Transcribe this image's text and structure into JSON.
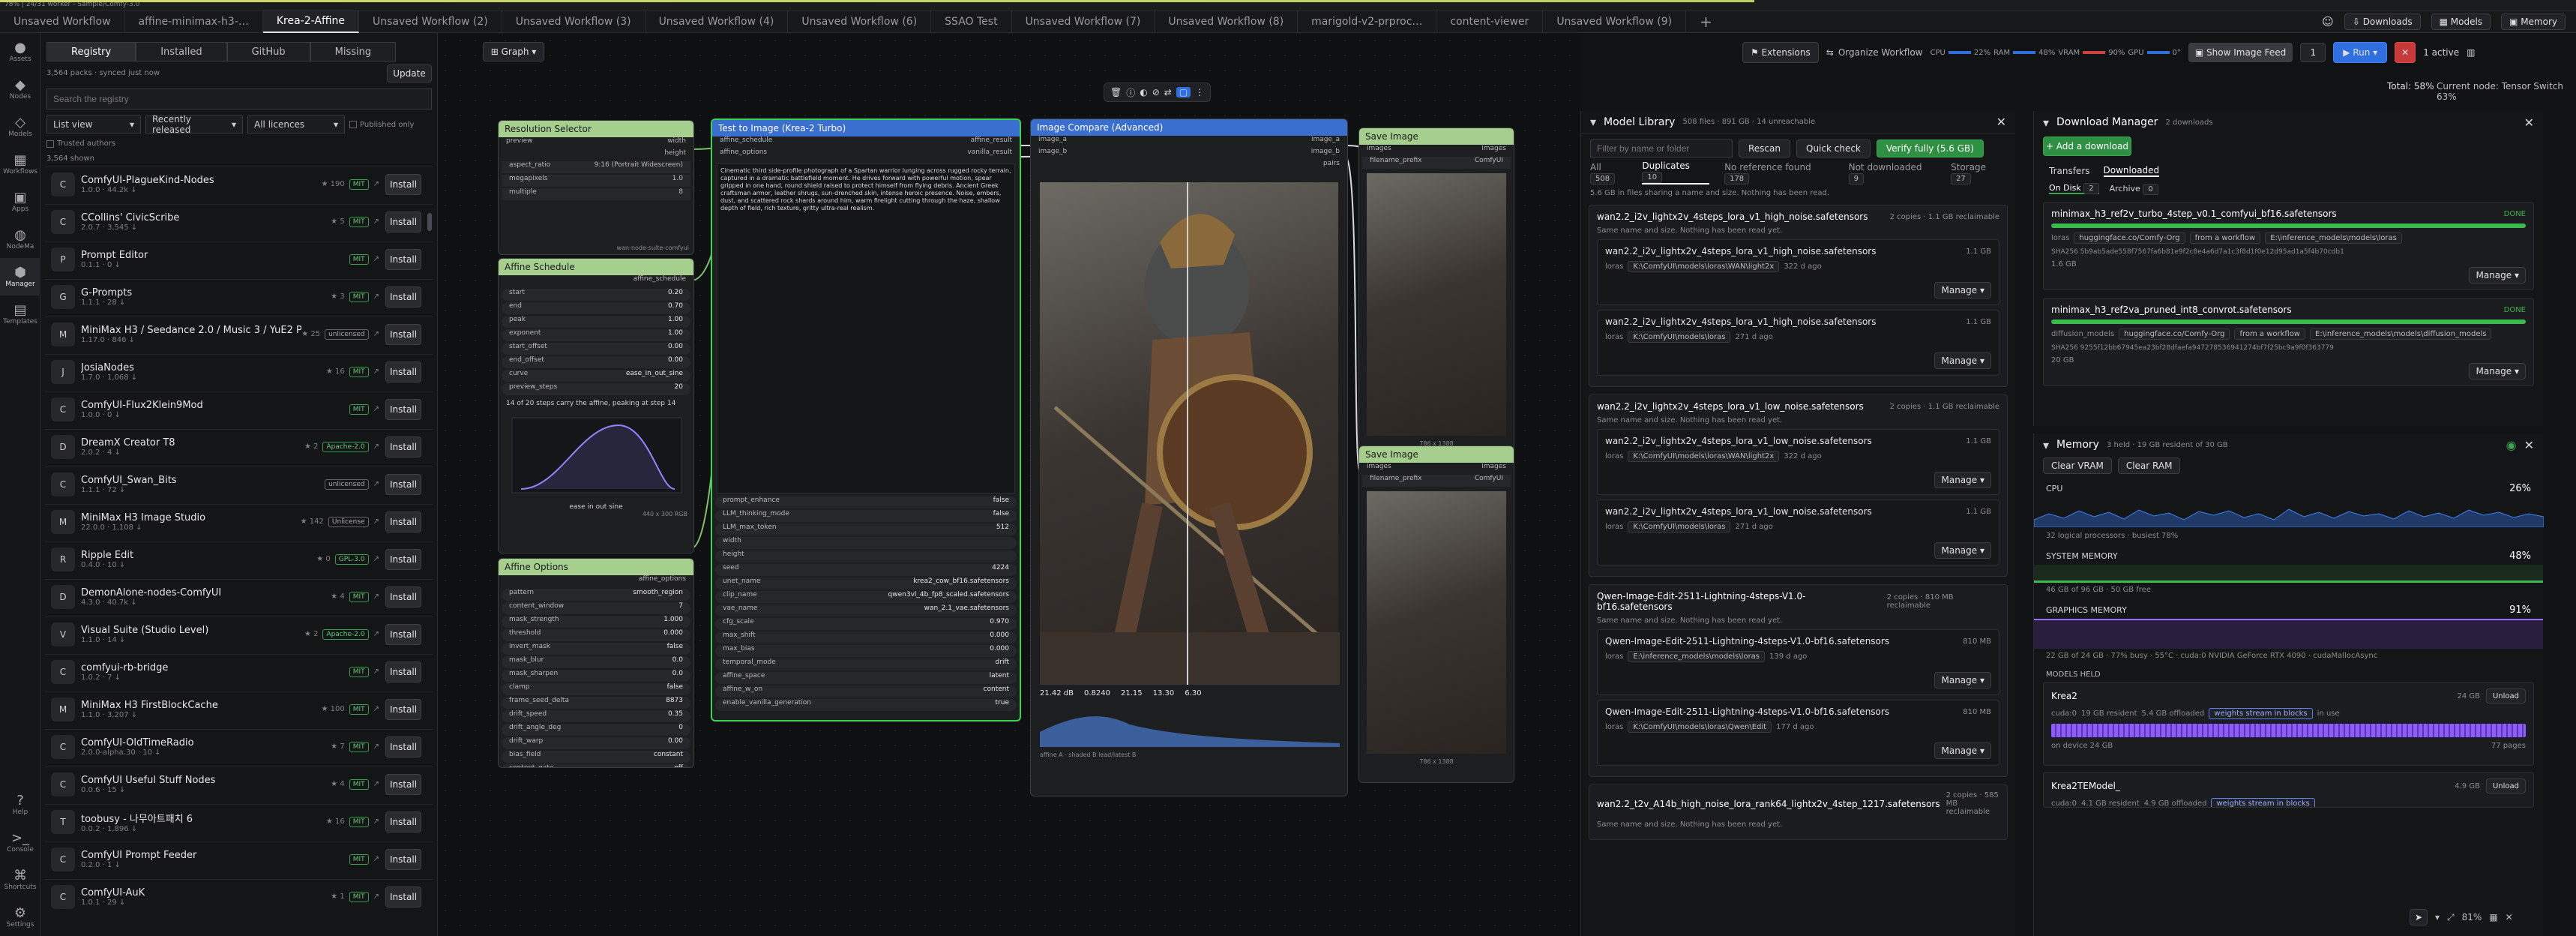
{
  "status_line": "78% | 24/31 worker - Sample/Comfy-3.0",
  "tabs": [
    "Unsaved Workflow",
    "affine-minimax-h3-…",
    "Krea-2-Affine",
    "Unsaved Workflow (2)",
    "Unsaved Workflow (3)",
    "Unsaved Workflow (4)",
    "Unsaved Workflow (6)",
    "SSAO Test",
    "Unsaved Workflow (7)",
    "Unsaved Workflow (8)",
    "marigold-v2-prproc…",
    "content-viewer",
    "Unsaved Workflow (9)"
  ],
  "topbar": {
    "downloads": "Downloads",
    "models": "Models",
    "memory": "Memory",
    "total": "Total: 58%",
    "current_node": "Current node: Tensor Switch 63%"
  },
  "rail": [
    {
      "icon": "●",
      "label": "Assets"
    },
    {
      "icon": "◆",
      "label": "Nodes"
    },
    {
      "icon": "◇",
      "label": "Models"
    },
    {
      "icon": "▦",
      "label": "Workflows"
    },
    {
      "icon": "▣",
      "label": "Apps"
    },
    {
      "icon": "◍",
      "label": "NodeMa"
    },
    {
      "icon": "⬢",
      "label": "Manager"
    },
    {
      "icon": "▤",
      "label": "Templates"
    },
    {
      "icon": "?",
      "label": "Help"
    },
    {
      "icon": ">_",
      "label": "Console"
    },
    {
      "icon": "⌘",
      "label": "Shortcuts"
    },
    {
      "icon": "⚙",
      "label": "Settings"
    }
  ],
  "manager": {
    "tabs": [
      "Registry",
      "Installed",
      "GitHub",
      "Missing"
    ],
    "count_line": "3,564 packs · synced just now",
    "update": "Update",
    "search_placeholder": "Search the registry",
    "view": "List view",
    "sort": "Recently released",
    "licences": "All licences",
    "published_only": "Published only",
    "trusted": "Trusted authors",
    "shown": "3,564 shown",
    "install": "Install",
    "packs": [
      {
        "icon": "C",
        "name": "ComfyUI-PlagueKind-Nodes",
        "meta": "1.0.0 · 44.2k ↓",
        "badge": "MIT",
        "stars": "★ 190"
      },
      {
        "icon": "C",
        "name": "CCollins' CivicScribe",
        "meta": "2.0.7 · 3,545 ↓",
        "badge": "MIT",
        "stars": "★ 5"
      },
      {
        "icon": "P",
        "name": "Prompt Editor",
        "meta": "0.1.1 · 0 ↓",
        "badge": "MIT",
        "stars": ""
      },
      {
        "icon": "G",
        "name": "G-Prompts",
        "meta": "1.1.1 · 28 ↓",
        "badge": "MIT",
        "stars": "★ 3"
      },
      {
        "icon": "M",
        "name": "MiniMax H3 / Seedance 2.0 / Music 3 / YuE2 Prompt Enhancer (TB)",
        "meta": "1.17.0 · 846 ↓",
        "badge": "unlicensed",
        "stars": "★ 25"
      },
      {
        "icon": "J",
        "name": "JosiaNodes",
        "meta": "1.7.0 · 1,068 ↓",
        "badge": "MIT",
        "stars": "★ 16"
      },
      {
        "icon": "C",
        "name": "ComfyUI-Flux2Klein9Mod",
        "meta": "1.0.0 · 0 ↓",
        "badge": "MIT",
        "stars": ""
      },
      {
        "icon": "D",
        "name": "DreamX Creator T8",
        "meta": "2.0.2 · 4 ↓",
        "badge": "Apache-2.0",
        "stars": "★ 2"
      },
      {
        "icon": "C",
        "name": "ComfyUI_Swan_Bits",
        "meta": "1.1.1 · 72 ↓",
        "badge": "unlicensed",
        "stars": ""
      },
      {
        "icon": "M",
        "name": "MiniMax H3 Image Studio",
        "meta": "22.0.0 · 1,108 ↓",
        "badge": "Unlicense",
        "stars": "★ 142"
      },
      {
        "icon": "R",
        "name": "Ripple Edit",
        "meta": "0.4.0 · 10 ↓",
        "badge": "GPL-3.0",
        "stars": "★ 0"
      },
      {
        "icon": "D",
        "name": "DemonAlone-nodes-ComfyUI",
        "meta": "4.3.0 · 40.7k ↓",
        "badge": "MIT",
        "stars": "★ 4"
      },
      {
        "icon": "V",
        "name": "Visual Suite (Studio Level)",
        "meta": "1.1.0 · 14 ↓",
        "badge": "Apache-2.0",
        "stars": "★ 2"
      },
      {
        "icon": "C",
        "name": "comfyui-rb-bridge",
        "meta": "1.0.2 · 7 ↓",
        "badge": "MIT",
        "stars": ""
      },
      {
        "icon": "M",
        "name": "MiniMax H3 FirstBlockCache",
        "meta": "1.1.0 · 3,207 ↓",
        "badge": "MIT",
        "stars": "★ 100"
      },
      {
        "icon": "C",
        "name": "ComfyUI-OldTimeRadio",
        "meta": "2.0.0-alpha.30 · 10 ↓",
        "badge": "MIT",
        "stars": "★ 7"
      },
      {
        "icon": "C",
        "name": "ComfyUI Useful Stuff Nodes",
        "meta": "0.0.6 · 15 ↓",
        "badge": "MIT",
        "stars": "★ 4"
      },
      {
        "icon": "T",
        "name": "toobusy - 나무아트패치 6",
        "meta": "0.0.2 · 1,896 ↓",
        "badge": "MIT",
        "stars": "★ 16"
      },
      {
        "icon": "C",
        "name": "ComfyUI Prompt Feeder",
        "meta": "0.2.0 · 1 ↓",
        "badge": "MIT",
        "stars": ""
      },
      {
        "icon": "C",
        "name": "ComfyUI-AuK",
        "meta": "1.0.1 · 29 ↓",
        "badge": "MIT",
        "stars": "★ 1"
      }
    ]
  },
  "graph": {
    "label": "Graph",
    "res_node": {
      "title": "Resolution Selector",
      "rows": [
        [
          "preview",
          "width"
        ],
        [
          "",
          "height"
        ],
        [
          "aspect_ratio",
          "9:16 (Portrait Widescreen)"
        ],
        [
          "megapixels",
          "1.0"
        ],
        [
          "multiple",
          "8"
        ]
      ],
      "tag": "wan-node-suite-comfyui"
    },
    "sched_node": {
      "title": "Affine Schedule",
      "out": "affine_schedule",
      "rows": [
        [
          "start",
          "0.20"
        ],
        [
          "end",
          "0.70"
        ],
        [
          "peak",
          "1.00"
        ],
        [
          "exponent",
          "1.00"
        ],
        [
          "start_offset",
          "0.00"
        ],
        [
          "end_offset",
          "0.00"
        ],
        [
          "curve",
          "ease_in_out_sine"
        ],
        [
          "preview_steps",
          "20"
        ]
      ],
      "note": "14 of 20 steps carry the affine, peaking at step 14",
      "foot": "440 x 300 RGB",
      "caption": "ease in out sine"
    },
    "opts_node": {
      "title": "Affine Options",
      "out": "affine_options",
      "rows": [
        [
          "pattern",
          "smooth_region"
        ],
        [
          "content_window",
          "7"
        ],
        [
          "mask_strength",
          "1.000"
        ],
        [
          "threshold",
          "0.000"
        ],
        [
          "invert_mask",
          "false"
        ],
        [
          "mask_blur",
          "0.0"
        ],
        [
          "mask_sharpen",
          "0.0"
        ],
        [
          "clamp",
          "false"
        ],
        [
          "frame_seed_delta",
          "8873"
        ],
        [
          "drift_speed",
          "0.35"
        ],
        [
          "drift_angle_deg",
          "0"
        ],
        [
          "drift_warp",
          "0.00"
        ],
        [
          "bias_field",
          "constant"
        ],
        [
          "content_gate",
          "off"
        ]
      ]
    },
    "t2i_node": {
      "title": "Test to Image (Krea-2 Turbo)",
      "ins": [
        "affine_schedule",
        "affine_options"
      ],
      "outs": [
        "affine_result",
        "vanilla_result"
      ],
      "prompt": "Cinematic third side-profile photograph of a Spartan warrior lunging across rugged rocky terrain, captured in a dramatic battlefield moment. He drives forward with powerful motion, spear gripped in one hand, round shield raised to protect himself from flying debris. Ancient Greek craftsman armor, leather shrugs, sun-drenched skin, intense heroic presence. Noise, embers, dust, and scattered rock shards around him, warm firelight cutting through the haze, shallow depth of field, rich texture, gritty ultra-real realism.",
      "rows": [
        [
          "prompt_enhance",
          "false"
        ],
        [
          "LLM_thinking_mode",
          "false"
        ],
        [
          "LLM_max_token",
          "512"
        ],
        [
          "width",
          ""
        ],
        [
          "height",
          ""
        ],
        [
          "seed",
          "4224"
        ],
        [
          "unet_name",
          "krea2_cow_bf16.safetensors"
        ],
        [
          "clip_name",
          "qwen3vl_4b_fp8_scaled.safetensors"
        ],
        [
          "vae_name",
          "wan_2.1_vae.safetensors"
        ],
        [
          "cfg_scale",
          "0.970"
        ],
        [
          "max_shift",
          "0.000"
        ],
        [
          "max_bias",
          "0.000"
        ],
        [
          "temporal_mode",
          "drift"
        ],
        [
          "affine_space",
          "latent"
        ],
        [
          "affine_w_on",
          "content"
        ],
        [
          "enable_vanilla_generation",
          "true"
        ]
      ]
    },
    "cmp_node": {
      "title": "Image Compare (Advanced)",
      "ins": [
        "image_a",
        "image_b"
      ],
      "outs": [
        "image_a",
        "image_b",
        "pairs"
      ],
      "stats": [
        "21.42 dB",
        "0.8240",
        "21.15",
        "13.30",
        "6.30"
      ],
      "foot": "affine A · shaded B lead/latest B"
    },
    "save1": {
      "title": "Save Image",
      "in": "images",
      "sub": "filename_prefix",
      "val": "ComfyUI",
      "foot": "786 x 1388"
    },
    "save2": {
      "title": "Save Image",
      "in": "images",
      "sub": "filename_prefix",
      "val": "ComfyUI",
      "foot": "786 x 1388"
    },
    "tag": "wan-node-suite-comfyui"
  },
  "library": {
    "title": "Model Library",
    "summary": "508 files · 891 GB · 14 unreachable",
    "filter_placeholder": "Filter by name or folder",
    "rescan": "Rescan",
    "quick": "Quick check",
    "verify": "Verify fully (5.6 GB)",
    "tabs": [
      [
        "All",
        "508"
      ],
      [
        "Duplicates",
        "10"
      ],
      [
        "No reference found",
        "178"
      ],
      [
        "Not downloaded",
        "9"
      ],
      [
        "Storage",
        "27"
      ]
    ],
    "note": "5.6 GB in files sharing a name and size. Nothing has been read.",
    "manage": "Manage ▾",
    "groups": [
      {
        "name": "wan2.2_i2v_lightx2v_4steps_lora_v1_high_noise.safetensors",
        "count": "2 copies · 1.1 GB reclaimable",
        "desc": "Same name and size. Nothing has been read yet.",
        "items": [
          {
            "name": "wan2.2_i2v_lightx2v_4steps_lora_v1_high_noise.safetensors",
            "size": "1.1 GB",
            "path": "K:\\ComfyUI\\models\\loras\\WAN\\light2x",
            "age": "322 d ago"
          },
          {
            "name": "wan2.2_i2v_lightx2v_4steps_lora_v1_high_noise.safetensors",
            "size": "1.1 GB",
            "path": "K:\\ComfyUI\\models\\loras",
            "age": "271 d ago"
          }
        ]
      },
      {
        "name": "wan2.2_i2v_lightx2v_4steps_lora_v1_low_noise.safetensors",
        "count": "2 copies · 1.1 GB reclaimable",
        "desc": "Same name and size. Nothing has been read yet.",
        "items": [
          {
            "name": "wan2.2_i2v_lightx2v_4steps_lora_v1_low_noise.safetensors",
            "size": "1.1 GB",
            "path": "K:\\ComfyUI\\models\\loras\\WAN\\light2x",
            "age": "322 d ago"
          },
          {
            "name": "wan2.2_i2v_lightx2v_4steps_lora_v1_low_noise.safetensors",
            "size": "1.1 GB",
            "path": "K:\\ComfyUI\\models\\loras",
            "age": "271 d ago"
          }
        ]
      },
      {
        "name": "Qwen-Image-Edit-2511-Lightning-4steps-V1.0-bf16.safetensors",
        "count": "2 copies · 810 MB reclaimable",
        "desc": "Same name and size. Nothing has been read yet.",
        "items": [
          {
            "name": "Qwen-Image-Edit-2511-Lightning-4steps-V1.0-bf16.safetensors",
            "size": "810 MB",
            "path": "E:\\inference_models\\models\\loras",
            "age": "139 d ago"
          },
          {
            "name": "Qwen-Image-Edit-2511-Lightning-4steps-V1.0-bf16.safetensors",
            "size": "810 MB",
            "path": "K:\\ComfyUI\\models\\loras\\Qwen\\Edit",
            "age": "177 d ago"
          }
        ]
      },
      {
        "name": "wan2.2_t2v_A14b_high_noise_lora_rank64_lightx2v_4step_1217.safetensors",
        "count": "2 copies · 585 MB reclaimable",
        "desc": "Same name and size. Nothing has been read yet.",
        "items": []
      }
    ]
  },
  "downloads": {
    "title": "Download Manager",
    "count": "2 downloads",
    "add": "+ Add a download",
    "tabs": [
      "Transfers",
      "Downloaded"
    ],
    "sub": [
      [
        "On Disk",
        "2"
      ],
      [
        "Archive",
        "0"
      ]
    ],
    "items": [
      {
        "name": "minimax_h3_ref2v_turbo_4step_v0.1_comfyui_bf16.safetensors",
        "status": "DONE",
        "folder": "loras",
        "source": "huggingface.co/Comfy-Org",
        "from": "from a workflow",
        "path": "E:\\inference_models\\models\\loras",
        "hash": "SHA256  5b9ab5ade558f7567fa6b81e9f2c8e4a6d7a1c3f8d1f0e12d95ad1a5f4b70cdb1",
        "size": "1.6 GB",
        "manage": "Manage ▾"
      },
      {
        "name": "minimax_h3_ref2va_pruned_int8_convrot.safetensors",
        "status": "DONE",
        "folder": "diffusion_models",
        "source": "huggingface.co/Comfy-Org",
        "from": "from a workflow",
        "path": "E:\\inference_models\\models\\diffusion_models",
        "hash": "SHA256  9255f12bb67945ea23bf28dfaefa947278536941274bf7f25bc9a9f0f363779",
        "size": "20 GB",
        "manage": "Manage ▾"
      }
    ]
  },
  "memory": {
    "title": "Memory",
    "summary": "3 held · 19 GB resident of 30 GB",
    "clear_vram": "Clear VRAM",
    "clear_ram": "Clear RAM",
    "cpu_label": "CPU",
    "cpu_val": "26%",
    "cpu_note": "32 logical processors · busiest 78%",
    "sys_label": "SYSTEM MEMORY",
    "sys_val": "48%",
    "sys_note": "46 GB of 96 GB · 50 GB free",
    "gpu_label": "GRAPHICS MEMORY",
    "gpu_val": "91%",
    "gpu_note": "22 GB of 24 GB · 77% busy · 55°C · cuda:0 NVIDIA GeForce RTX 4090 · cudaMallocAsync",
    "held_label": "MODELS HELD",
    "models": [
      {
        "name": "Krea2",
        "size": "24 GB",
        "unload": "Unload",
        "chips": [
          "cuda:0",
          "19 GB resident",
          "5.4 GB offloaded",
          "weights stream in blocks",
          "in use"
        ],
        "foot": "on device 24 GB",
        "blocks": "77 pages"
      },
      {
        "name": "Krea2TEModel_",
        "size": "4.9 GB",
        "unload": "Unload",
        "chips": [
          "cuda:0",
          "4.1 GB resident",
          "4.9 GB offloaded",
          "weights stream in blocks"
        ]
      }
    ]
  },
  "runbar": {
    "extensions": "Extensions",
    "organize": "Organize Workflow",
    "cpu": "CPU",
    "cpu_v": "22%",
    "ram": "RAM",
    "ram_v": "48%",
    "vram": "VRAM",
    "vram_v": "90%",
    "gpu": "GPU",
    "gpu_v": "0°",
    "feed": "Show Image Feed",
    "queue": "1",
    "run": "Run",
    "active": "1 active"
  },
  "zoom": "81%",
  "colors": {
    "accent": "#3aa451",
    "node_header": "#a6cf8e",
    "selected": "#3bd34f",
    "run": "#2f6fe0",
    "close": "#c83a3a"
  }
}
